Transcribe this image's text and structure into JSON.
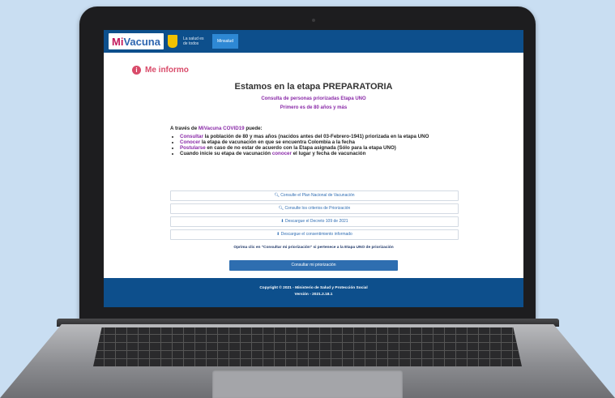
{
  "header": {
    "logo_mi": "Mi",
    "logo_vacuna": "Vacuna",
    "gov_text": "La salud es de todos",
    "gov_button": "Minsalud"
  },
  "section": {
    "badge": "i",
    "title": "Me informo"
  },
  "main": {
    "stage_title": "Estamos en la etapa PREPARATORIA",
    "subtitle_1": "Consulta de personas priorizadas Etapa UNO",
    "subtitle_2": "Primero es de 80 años y más"
  },
  "info": {
    "intro_pre": "A través de ",
    "intro_highlight": "MiVacuna COVID19",
    "intro_post": " puede:",
    "items": [
      {
        "link": "Consultar",
        "text": " la población de 80 y mas años (nacidos antes del 03-Febrero-1941) priorizada en la etapa UNO"
      },
      {
        "link": "Conocer",
        "text": " la etapa de vacunación en que se encuentra Colombia a la fecha"
      },
      {
        "link": "Postularse",
        "text": " en caso de no estar de acuerdo con la Etapa asignada (Sólo para la etapa UNO)"
      },
      {
        "pre": "Cuando inicie su etapa de vacunación ",
        "link": "conocer",
        "text": " el lugar y fecha de vacunación"
      }
    ]
  },
  "links": [
    {
      "icon": "search-icon",
      "glyph": "🔍︎",
      "label": "Consulte el Plan Nacional de Vacunación"
    },
    {
      "icon": "search-icon",
      "glyph": "🔍︎",
      "label": "Consulte los criterios de Priorización"
    },
    {
      "icon": "download-icon",
      "glyph": "⬇",
      "label": "Descargue el Decreto 109 de 2021"
    },
    {
      "icon": "download-icon",
      "glyph": "⬇",
      "label": "Descargue el consentimiento informado"
    }
  ],
  "note": "Oprima clic en \"Consultar mi priorización\" si pertenece a la Etapa UNO de priorización",
  "cta_label": "Consultar mi priorización",
  "footer": {
    "line1": "Copyright © 2021 - Ministerio de Salud y Protección Social",
    "line2": "Versión - 2021.2.18.1"
  },
  "colors": {
    "header_blue": "#0d4f8c",
    "accent_purple": "#8a2aa8",
    "accent_pink": "#d94b6a",
    "background": "#c9def2"
  }
}
